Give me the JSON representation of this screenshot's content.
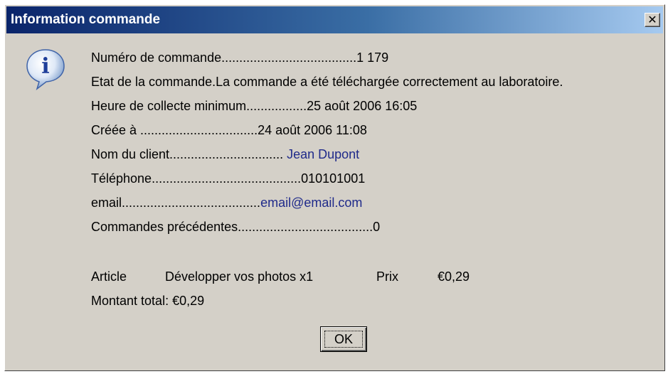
{
  "window": {
    "title": "Information commande",
    "close_glyph": "✕"
  },
  "icon": {
    "name": "info-icon",
    "letter": "i"
  },
  "details": [
    {
      "label": "Numéro de commande......................................",
      "value": "1 179"
    },
    {
      "label": "Etat de la commande.",
      "value": "La commande a été téléchargée correctement au laboratoire."
    },
    {
      "label": "Heure de collecte minimum.................",
      "value": "25 août 2006 16:05"
    },
    {
      "label": "Créée à .................................",
      "value": "24 août 2006 11:08"
    },
    {
      "label": "Nom du client................................",
      "value": " Jean Dupont"
    },
    {
      "label": "Téléphone..........................................",
      "value": "010101001"
    },
    {
      "label": "email.......................................",
      "value": "email@email.com"
    },
    {
      "label": "Commandes précédentes......................................",
      "value": "0"
    }
  ],
  "article": {
    "label": "Article",
    "description": "Développer vos photos x1",
    "price_label": "Prix",
    "price": "€0,29"
  },
  "total": {
    "label": "Montant total:",
    "value": "€0,29"
  },
  "ok_label": "OK"
}
